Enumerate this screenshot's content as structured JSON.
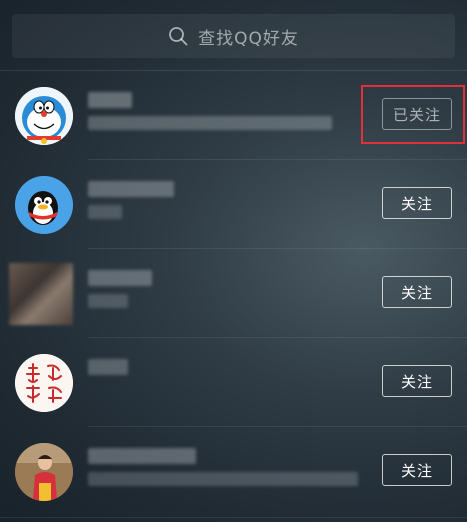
{
  "search": {
    "placeholder": "查找QQ好友",
    "icon": "search-icon"
  },
  "list": [
    {
      "follow_label": "已关注",
      "followed": true,
      "highlighted": true,
      "avatar": "doraemon"
    },
    {
      "follow_label": "关注",
      "followed": false,
      "highlighted": false,
      "avatar": "penguin"
    },
    {
      "follow_label": "关注",
      "followed": false,
      "highlighted": false,
      "avatar": "blurred-photo"
    },
    {
      "follow_label": "关注",
      "followed": false,
      "highlighted": false,
      "avatar": "calligraphy-seal"
    },
    {
      "follow_label": "关注",
      "followed": false,
      "highlighted": false,
      "avatar": "person-photo"
    }
  ],
  "colors": {
    "highlight": "#e0313a",
    "background": "#1f2a33"
  }
}
